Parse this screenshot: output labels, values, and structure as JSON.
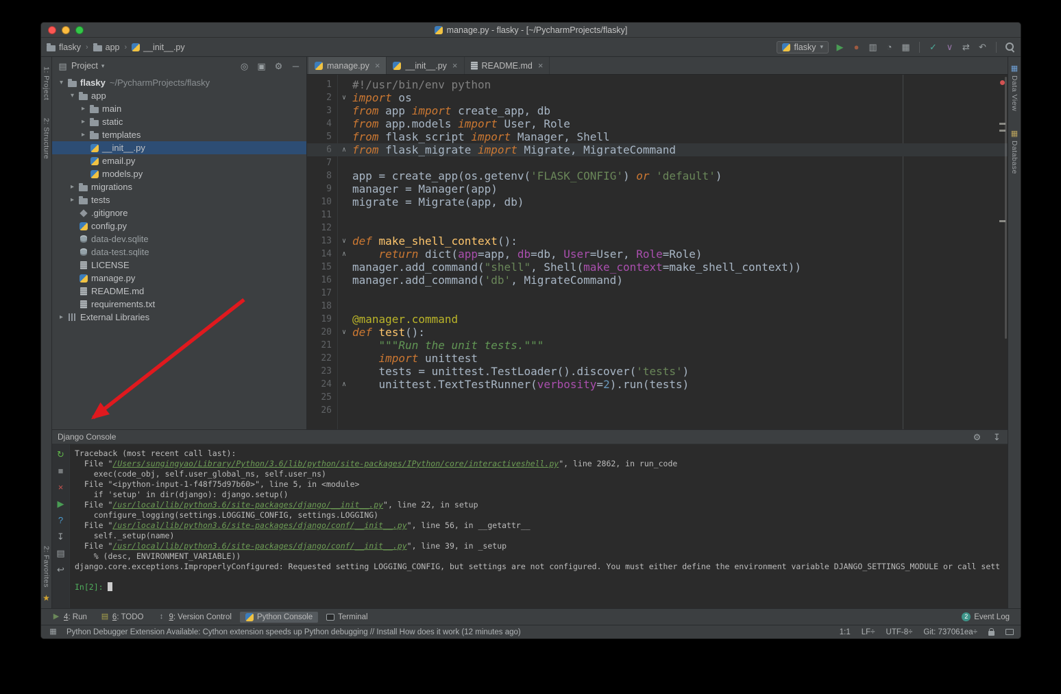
{
  "window": {
    "title": "manage.py - flasky - [~/PycharmProjects/flasky]"
  },
  "toolbar": {
    "breadcrumbs": [
      {
        "label": "flasky",
        "icon": "folder-icon"
      },
      {
        "label": "app",
        "icon": "folder-icon"
      },
      {
        "label": "__init__.py",
        "icon": "python-file-icon"
      }
    ],
    "run_config": {
      "label": "flasky"
    },
    "actions": [
      {
        "name": "run-icon",
        "glyph": "▶",
        "color": "#499c54"
      },
      {
        "name": "debug-icon",
        "glyph": "●",
        "color": "#9e5a41"
      },
      {
        "name": "coverage-icon",
        "glyph": "▥",
        "color": "#9aa0a3"
      },
      {
        "name": "profiler-icon",
        "glyph": "◔",
        "color": "#9aa0a3"
      },
      {
        "name": "concurrency-icon",
        "glyph": "▦",
        "color": "#9aa0a3"
      },
      {
        "name": "separator"
      },
      {
        "name": "vcs-commit-icon",
        "glyph": "✓",
        "color": "#4dab9a"
      },
      {
        "name": "vcs-update-icon",
        "glyph": "∨",
        "color": "#9876aa"
      },
      {
        "name": "vcs-compare-icon",
        "glyph": "⇄",
        "color": "#9aa0a3"
      },
      {
        "name": "revert-icon",
        "glyph": "↶",
        "color": "#9aa0a3"
      },
      {
        "name": "separator"
      },
      {
        "name": "search-icon",
        "shape": "magnifier"
      }
    ]
  },
  "left_stripe": {
    "top": [
      {
        "label": "1: Project"
      },
      {
        "label": "2: Structure"
      }
    ],
    "bottom": [
      {
        "label": "2: Favorites"
      }
    ]
  },
  "right_stripe": {
    "items": [
      {
        "icon": "data-view-icon",
        "glyph": "▦",
        "color": "#6e9fd4",
        "label": "Data View"
      },
      {
        "icon": "database-icon",
        "glyph": "▦",
        "color": "#b8a15c",
        "label": "Database"
      }
    ]
  },
  "project": {
    "header": {
      "label": "Project",
      "actions": [
        {
          "name": "locate-icon",
          "glyph": "◎"
        },
        {
          "name": "flatten-icon",
          "glyph": "▣"
        },
        {
          "name": "settings-icon",
          "glyph": "⚙"
        },
        {
          "name": "hide-icon",
          "glyph": "─"
        }
      ]
    },
    "tree": [
      {
        "indent": 0,
        "expander": "open",
        "icon": "folder-icon",
        "label": "flasky",
        "suffix": "~/PycharmProjects/flasky",
        "bold": true
      },
      {
        "indent": 1,
        "expander": "open",
        "icon": "folder-icon",
        "label": "app"
      },
      {
        "indent": 2,
        "expander": "closed",
        "icon": "folder-icon",
        "label": "main"
      },
      {
        "indent": 2,
        "expander": "closed",
        "icon": "folder-icon",
        "label": "static"
      },
      {
        "indent": 2,
        "expander": "closed",
        "icon": "folder-icon",
        "label": "templates"
      },
      {
        "indent": 2,
        "expander": null,
        "icon": "python-file-icon",
        "label": "__init__.py",
        "selected": true
      },
      {
        "indent": 2,
        "expander": null,
        "icon": "python-file-icon",
        "label": "email.py"
      },
      {
        "indent": 2,
        "expander": null,
        "icon": "python-file-icon",
        "label": "models.py"
      },
      {
        "indent": 1,
        "expander": "closed",
        "icon": "folder-icon",
        "label": "migrations"
      },
      {
        "indent": 1,
        "expander": "closed",
        "icon": "folder-icon",
        "label": "tests"
      },
      {
        "indent": 1,
        "expander": null,
        "icon": "gitignore-icon",
        "label": ".gitignore"
      },
      {
        "indent": 1,
        "expander": null,
        "icon": "python-file-icon",
        "label": "config.py"
      },
      {
        "indent": 1,
        "expander": null,
        "icon": "database-file-icon",
        "label": "data-dev.sqlite",
        "dim": true
      },
      {
        "indent": 1,
        "expander": null,
        "icon": "database-file-icon",
        "label": "data-test.sqlite",
        "dim": true
      },
      {
        "indent": 1,
        "expander": null,
        "icon": "text-file-icon",
        "label": "LICENSE"
      },
      {
        "indent": 1,
        "expander": null,
        "icon": "python-file-icon",
        "label": "manage.py"
      },
      {
        "indent": 1,
        "expander": null,
        "icon": "text-file-icon",
        "label": "README.md"
      },
      {
        "indent": 1,
        "expander": null,
        "icon": "text-file-icon",
        "label": "requirements.txt"
      },
      {
        "indent": 0,
        "expander": "closed",
        "icon": "libraries-icon",
        "label": "External Libraries"
      }
    ]
  },
  "editor": {
    "tabs": [
      {
        "label": "manage.py",
        "icon": "python-file-icon",
        "active": true
      },
      {
        "label": "__init__.py",
        "icon": "python-file-icon",
        "active": false
      },
      {
        "label": "README.md",
        "icon": "text-file-icon",
        "active": false
      }
    ],
    "lines": [
      {
        "num": "1",
        "tokens": [
          [
            "cmt",
            "#!/usr/bin/env python"
          ]
        ]
      },
      {
        "num": "2",
        "fold": "start",
        "tokens": [
          [
            "kw",
            "import"
          ],
          [
            "pl",
            " os"
          ]
        ]
      },
      {
        "num": "3",
        "tokens": [
          [
            "kw",
            "from"
          ],
          [
            "pl",
            " app "
          ],
          [
            "kw",
            "import"
          ],
          [
            "pl",
            " create_app, db"
          ]
        ]
      },
      {
        "num": "4",
        "tokens": [
          [
            "kw",
            "from"
          ],
          [
            "pl",
            " app.models "
          ],
          [
            "kw",
            "import"
          ],
          [
            "pl",
            " User, Role"
          ]
        ]
      },
      {
        "num": "5",
        "tokens": [
          [
            "kw",
            "from"
          ],
          [
            "pl",
            " flask_script "
          ],
          [
            "kw",
            "import"
          ],
          [
            "pl",
            " Manager, Shell"
          ]
        ]
      },
      {
        "num": "6",
        "fold": "end",
        "caret": true,
        "tokens": [
          [
            "kw",
            "from"
          ],
          [
            "pl",
            " flask_migrate "
          ],
          [
            "kw",
            "import"
          ],
          [
            "pl",
            " Migrate, MigrateCommand"
          ]
        ]
      },
      {
        "num": "7",
        "tokens": []
      },
      {
        "num": "8",
        "tokens": [
          [
            "pl",
            "app = create_app(os.getenv("
          ],
          [
            "str",
            "'FLASK_CONFIG'"
          ],
          [
            "pl",
            ") "
          ],
          [
            "kw",
            "or"
          ],
          [
            "pl",
            " "
          ],
          [
            "str",
            "'default'"
          ],
          [
            "pl",
            ")"
          ]
        ]
      },
      {
        "num": "9",
        "tokens": [
          [
            "pl",
            "manager = Manager(app)"
          ]
        ]
      },
      {
        "num": "10",
        "tokens": [
          [
            "pl",
            "migrate = Migrate(app, db)"
          ]
        ]
      },
      {
        "num": "11",
        "tokens": []
      },
      {
        "num": "12",
        "tokens": []
      },
      {
        "num": "13",
        "fold": "start",
        "tokens": [
          [
            "kw",
            "def"
          ],
          [
            "pl",
            " "
          ],
          [
            "fn",
            "make_shell_context"
          ],
          [
            "pl",
            "():"
          ]
        ]
      },
      {
        "num": "14",
        "fold": "end",
        "tokens": [
          [
            "pl",
            "    "
          ],
          [
            "kw",
            "return"
          ],
          [
            "pl",
            " dict("
          ],
          [
            "arg",
            "app"
          ],
          [
            "pl",
            "=app, "
          ],
          [
            "arg",
            "db"
          ],
          [
            "pl",
            "=db, "
          ],
          [
            "arg",
            "User"
          ],
          [
            "pl",
            "=User, "
          ],
          [
            "arg",
            "Role"
          ],
          [
            "pl",
            "=Role)"
          ]
        ]
      },
      {
        "num": "15",
        "tokens": [
          [
            "pl",
            "manager.add_command("
          ],
          [
            "str",
            "\"shell\""
          ],
          [
            "pl",
            ", Shell("
          ],
          [
            "arg",
            "make_context"
          ],
          [
            "pl",
            "=make_shell_context))"
          ]
        ]
      },
      {
        "num": "16",
        "tokens": [
          [
            "pl",
            "manager.add_command("
          ],
          [
            "str",
            "'db'"
          ],
          [
            "pl",
            ", MigrateCommand)"
          ]
        ]
      },
      {
        "num": "17",
        "tokens": []
      },
      {
        "num": "18",
        "tokens": []
      },
      {
        "num": "19",
        "tokens": [
          [
            "dec",
            "@manager.command"
          ]
        ]
      },
      {
        "num": "20",
        "fold": "start",
        "tokens": [
          [
            "kw",
            "def"
          ],
          [
            "pl",
            " "
          ],
          [
            "fn",
            "test"
          ],
          [
            "pl",
            "():"
          ]
        ]
      },
      {
        "num": "21",
        "tokens": [
          [
            "pl",
            "    "
          ],
          [
            "doc",
            "\"\"\"Run the unit tests.\"\"\""
          ]
        ]
      },
      {
        "num": "22",
        "tokens": [
          [
            "pl",
            "    "
          ],
          [
            "kw",
            "import"
          ],
          [
            "pl",
            " unittest"
          ]
        ]
      },
      {
        "num": "23",
        "tokens": [
          [
            "pl",
            "    tests = unittest.TestLoader().discover("
          ],
          [
            "str",
            "'tests'"
          ],
          [
            "pl",
            ")"
          ]
        ]
      },
      {
        "num": "24",
        "fold": "end",
        "tokens": [
          [
            "pl",
            "    unittest.TextTestRunner("
          ],
          [
            "arg",
            "verbosity"
          ],
          [
            "pl",
            "="
          ],
          [
            "lit",
            "2"
          ],
          [
            "pl",
            ").run(tests)"
          ]
        ]
      },
      {
        "num": "25",
        "tokens": []
      },
      {
        "num": "26",
        "tokens": []
      }
    ]
  },
  "console": {
    "title": "Django Console",
    "header_actions": [
      {
        "name": "settings-icon",
        "glyph": "⚙"
      },
      {
        "name": "scroll-to-bottom-icon",
        "glyph": "↧"
      }
    ],
    "toolbar": [
      {
        "name": "rerun-icon",
        "glyph": "↻",
        "color": "#5fb349"
      },
      {
        "name": "stop-icon",
        "glyph": "■",
        "color": "#777b7d"
      },
      {
        "name": "close-icon",
        "glyph": "×",
        "color": "#c75450"
      },
      {
        "name": "run-icon",
        "glyph": "▶",
        "color": "#499c54"
      },
      {
        "name": "help-icon",
        "glyph": "?",
        "color": "#4b9bcf"
      },
      {
        "name": "scroll-to-end-icon",
        "glyph": "↧",
        "color": "#9aa0a3"
      },
      {
        "name": "print-icon",
        "glyph": "▤",
        "color": "#9aa0a3"
      },
      {
        "name": "soft-wrap-icon",
        "glyph": "↩",
        "color": "#9aa0a3"
      }
    ],
    "lines": [
      {
        "tokens": [
          [
            "pl",
            "Traceback (most recent call last):"
          ]
        ]
      },
      {
        "tokens": [
          [
            "pl",
            "  File \""
          ],
          [
            "link",
            "/Users/sungingyao/Library/Python/3.6/lib/python/site-packages/IPython/core/interactiveshell.py"
          ],
          [
            "pl",
            "\", line 2862, in run_code"
          ]
        ]
      },
      {
        "tokens": [
          [
            "pl",
            "    exec(code_obj, self.user_global_ns, self.user_ns)"
          ]
        ]
      },
      {
        "tokens": [
          [
            "pl",
            "  File \"<ipython-input-1-f48f75d97b60>\", line 5, in <module>"
          ]
        ]
      },
      {
        "tokens": [
          [
            "pl",
            "    if 'setup' in dir(django): django.setup()"
          ]
        ]
      },
      {
        "tokens": [
          [
            "pl",
            "  File \""
          ],
          [
            "link",
            "/usr/local/lib/python3.6/site-packages/django/__init__.py"
          ],
          [
            "pl",
            "\", line 22, in setup"
          ]
        ]
      },
      {
        "tokens": [
          [
            "pl",
            "    configure_logging(settings.LOGGING_CONFIG, settings.LOGGING)"
          ]
        ]
      },
      {
        "tokens": [
          [
            "pl",
            "  File \""
          ],
          [
            "link",
            "/usr/local/lib/python3.6/site-packages/django/conf/__init__.py"
          ],
          [
            "pl",
            "\", line 56, in __getattr__"
          ]
        ]
      },
      {
        "tokens": [
          [
            "pl",
            "    self._setup(name)"
          ]
        ]
      },
      {
        "tokens": [
          [
            "pl",
            "  File \""
          ],
          [
            "link",
            "/usr/local/lib/python3.6/site-packages/django/conf/__init__.py"
          ],
          [
            "pl",
            "\", line 39, in _setup"
          ]
        ]
      },
      {
        "tokens": [
          [
            "pl",
            "    % (desc, ENVIRONMENT_VARIABLE))"
          ]
        ]
      },
      {
        "tokens": [
          [
            "pl",
            "django.core.exceptions.ImproperlyConfigured: Requested setting LOGGING_CONFIG, but settings are not configured. You must either define the environment variable DJANGO_SETTINGS_MODULE or call sett"
          ]
        ]
      },
      {
        "tokens": []
      },
      {
        "tokens": [
          [
            "prompt",
            "In[2]: "
          ],
          [
            "cursor",
            ""
          ]
        ]
      }
    ]
  },
  "tool_buttons": {
    "left": [
      {
        "label": "4: Run",
        "mnemonic": true,
        "icon": {
          "name": "run-tab-icon",
          "glyph": "▶",
          "color": "#6a8759"
        }
      },
      {
        "label": "6: TODO",
        "mnemonic": true,
        "icon": {
          "name": "todo-icon",
          "glyph": "▤",
          "color": "#a8a24c"
        }
      },
      {
        "label": "9: Version Control",
        "mnemonic": true,
        "icon": {
          "name": "version-control-icon",
          "glyph": "↕",
          "color": "#9aa0a3"
        }
      },
      {
        "label": "Python Console",
        "active": true,
        "icon": {
          "name": "python-console-icon",
          "css": "ic-python-file-icon"
        }
      },
      {
        "label": "Terminal",
        "icon": {
          "name": "terminal-icon",
          "css": "ic-terminal-icon"
        }
      }
    ],
    "right": [
      {
        "label": "Event Log",
        "icon": {
          "name": "event-log-badge",
          "badge": "2"
        }
      }
    ]
  },
  "status_bar": {
    "message": "Python Debugger Extension Available: Cython extension speeds up Python debugging // Install How does it work (12 minutes ago)",
    "right": [
      {
        "name": "caret-position",
        "label": "1:1"
      },
      {
        "name": "line-separator",
        "label": "LF÷"
      },
      {
        "name": "encoding",
        "label": "UTF-8÷"
      },
      {
        "name": "git-branch",
        "label": "Git: 737061ea÷"
      }
    ]
  }
}
